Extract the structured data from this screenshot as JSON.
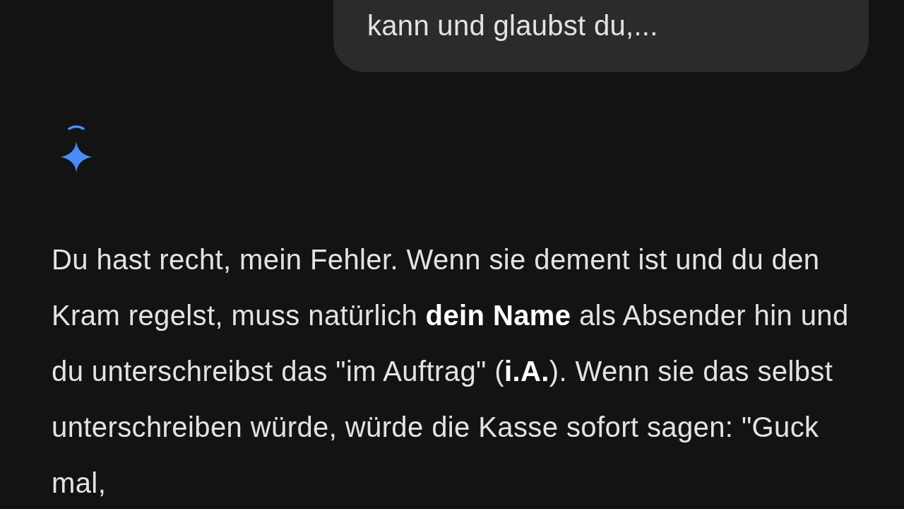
{
  "user_message": {
    "text": "kann und glaubst du,..."
  },
  "response": {
    "text": "Du hast recht, mein Fehler. Wenn sie dement ist und du den Kram regelst, muss natürlich **dein Name** als Absender hin und du unterschreibst das \"im Auftrag\" (**i.A.**). Wenn sie das selbst unterschreiben würde, würde die Kasse sofort sagen: \"Guck mal,"
  }
}
